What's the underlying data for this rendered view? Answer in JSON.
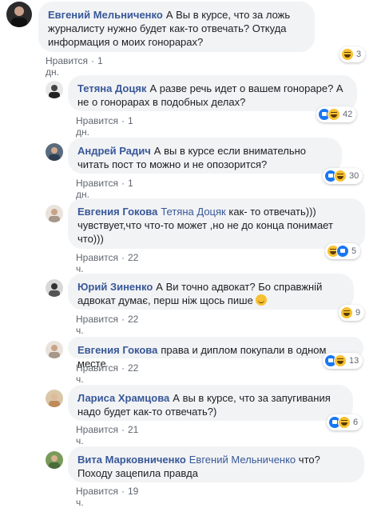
{
  "comments": [
    {
      "author": "Евгений Мельниченко",
      "mention": "",
      "text": "А Вы в курсе, что за ложь журналисту нужно будет как-то отвечать? Откуда информация о моих гонорарах?",
      "like_label": "Нравится",
      "time": "1 дн.",
      "reaction_count": "3",
      "reactions": [
        "haha"
      ]
    },
    {
      "author": "Тетяна Доцяк",
      "mention": "",
      "text": "А разве речь идет о вашем гонораре? А не о гонорарах в подобных делах?",
      "like_label": "Нравится",
      "time": "1 дн.",
      "reaction_count": "42",
      "reactions": [
        "like",
        "haha"
      ]
    },
    {
      "author": "Андрей Радич",
      "mention": "",
      "text": "А вы в курсе если внимательно читать пост то можно и не опозорится?",
      "like_label": "Нравится",
      "time": "1 дн.",
      "reaction_count": "30",
      "reactions": [
        "like",
        "haha"
      ]
    },
    {
      "author": "Евгения Гокова",
      "mention": "Тетяна Доцяк",
      "text": "как- то отвечать))) чувствует,что что-то может ,но не до конца понимает что)))",
      "like_label": "Нравится",
      "time": "22 ч.",
      "reaction_count": "5",
      "reactions": [
        "haha",
        "like"
      ]
    },
    {
      "author": "Юрий Зиненко",
      "mention": "",
      "text": "А Ви точно адвокат? Бо справжній адвокат думає, перш ніж щось пише",
      "like_label": "Нравится",
      "time": "22 ч.",
      "reaction_count": "9",
      "reactions": [
        "haha"
      ]
    },
    {
      "author": "Евгения Гокова",
      "mention": "",
      "text": "права и диплом покупали в одном месте",
      "like_label": "Нравится",
      "time": "22 ч.",
      "reaction_count": "13",
      "reactions": [
        "like",
        "haha"
      ]
    },
    {
      "author": "Лариса Храмцова",
      "mention": "",
      "text": "А вы в курсе, что за запугивания надо будет как-то отвечать?)",
      "like_label": "Нравится",
      "time": "21 ч.",
      "reaction_count": "6",
      "reactions": [
        "like",
        "haha"
      ]
    },
    {
      "author": "Вита Марковниченко",
      "mention": "Евгений Мельниченко",
      "text": "что? Походу зацепила правда",
      "like_label": "Нравится",
      "time": "19 ч.",
      "reaction_count": "",
      "reactions": []
    }
  ],
  "colors": {
    "link": "#385898",
    "bubble": "#f2f3f5",
    "like": "#1877f2",
    "haha": "#f7c131"
  },
  "icons": [
    "like-reaction-icon",
    "haha-reaction-icon",
    "smile-emoji-icon"
  ]
}
